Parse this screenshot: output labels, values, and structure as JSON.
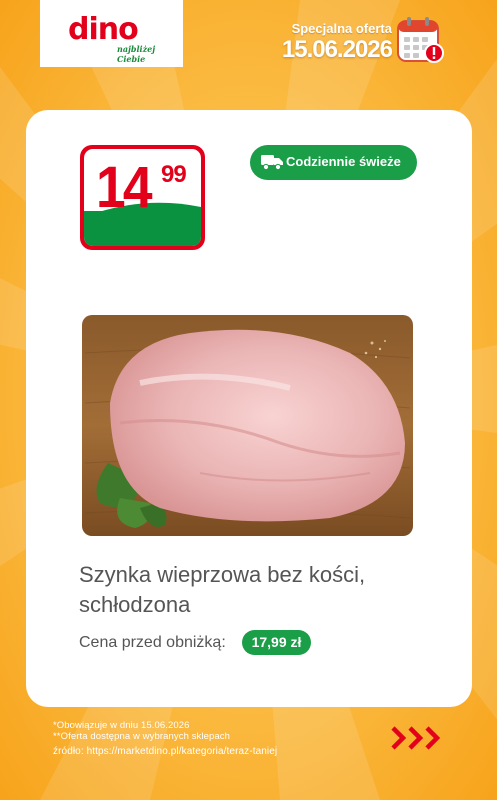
{
  "brand": {
    "logo_text": "dino",
    "tagline": "najbliżej Ciebie",
    "color_red": "#e2001a",
    "color_green": "#1a9e48"
  },
  "offer": {
    "label": "Specjalna oferta",
    "date": "15.06.2026",
    "icon": "calendar-alert-icon"
  },
  "price": {
    "integer": "14",
    "decimal": "99"
  },
  "badge": {
    "label": "Codziennie świeże",
    "icon": "delivery-truck-icon"
  },
  "product": {
    "name": "Szynka wieprzowa bez kości, schłodzona",
    "image": "pork-ham-on-wooden-board"
  },
  "previous_price": {
    "label": "Cena przed obniżką:",
    "value": "17,99 zł"
  },
  "footer": {
    "note1": "*Obowiązuje w dniu 15.06.2026",
    "note2": "**Oferta dostępna w wybranych sklepach",
    "source": "źródło: https://marketdino.pl/kategoria/teraz-taniej",
    "next_icon": "triple-chevron-right-icon"
  }
}
